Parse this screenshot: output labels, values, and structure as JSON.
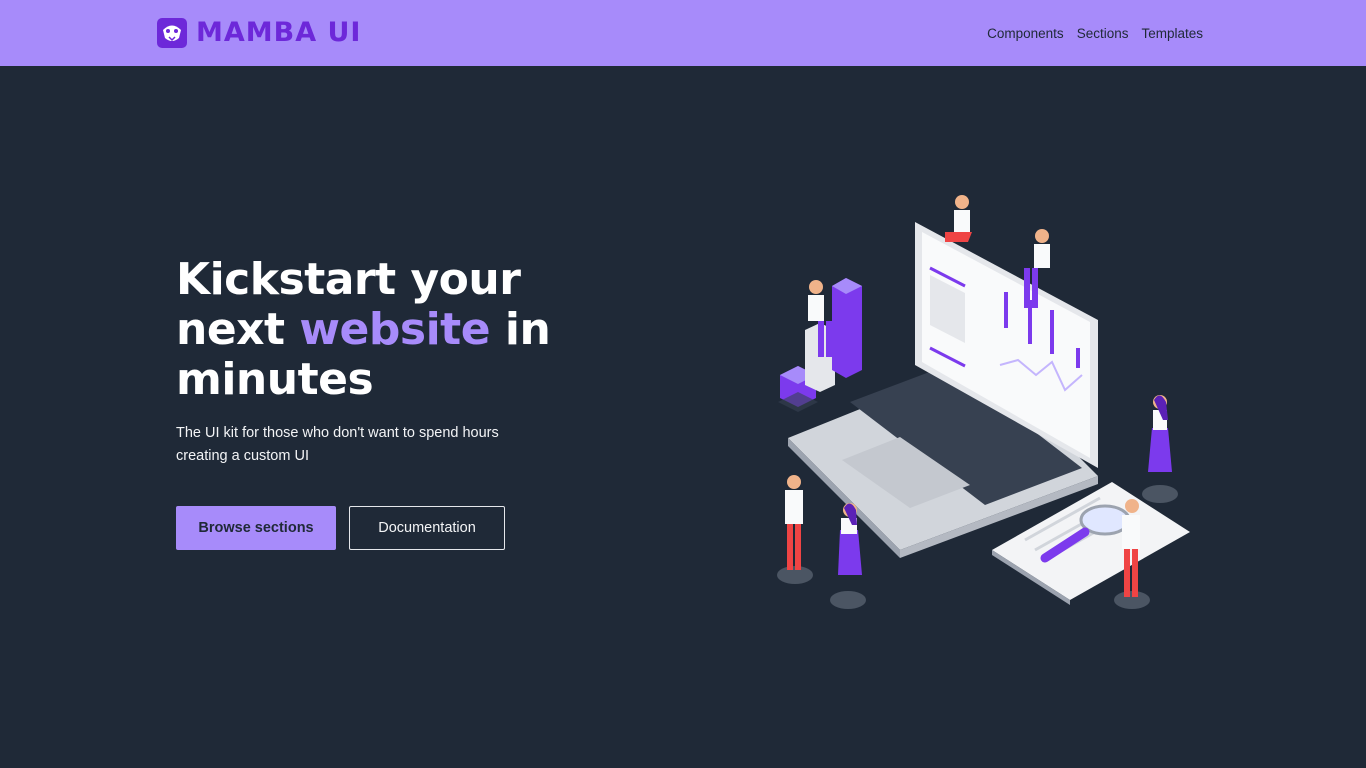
{
  "brand": {
    "name": "MAMBA UI",
    "accent": "#a78bfa",
    "accent_dark": "#6d28d9",
    "background": "#1f2937"
  },
  "nav": {
    "links": [
      {
        "label": "Components"
      },
      {
        "label": "Sections"
      },
      {
        "label": "Templates"
      }
    ]
  },
  "hero": {
    "title_part1": "Kickstart your next ",
    "title_accent": "website",
    "title_part2": " in minutes",
    "subtitle": "The UI kit for those who don't want to spend hours creating a custom UI",
    "primary_button": "Browse sections",
    "secondary_button": "Documentation"
  },
  "illustration": {
    "icon": "isometric-laptop-team-illustration"
  }
}
